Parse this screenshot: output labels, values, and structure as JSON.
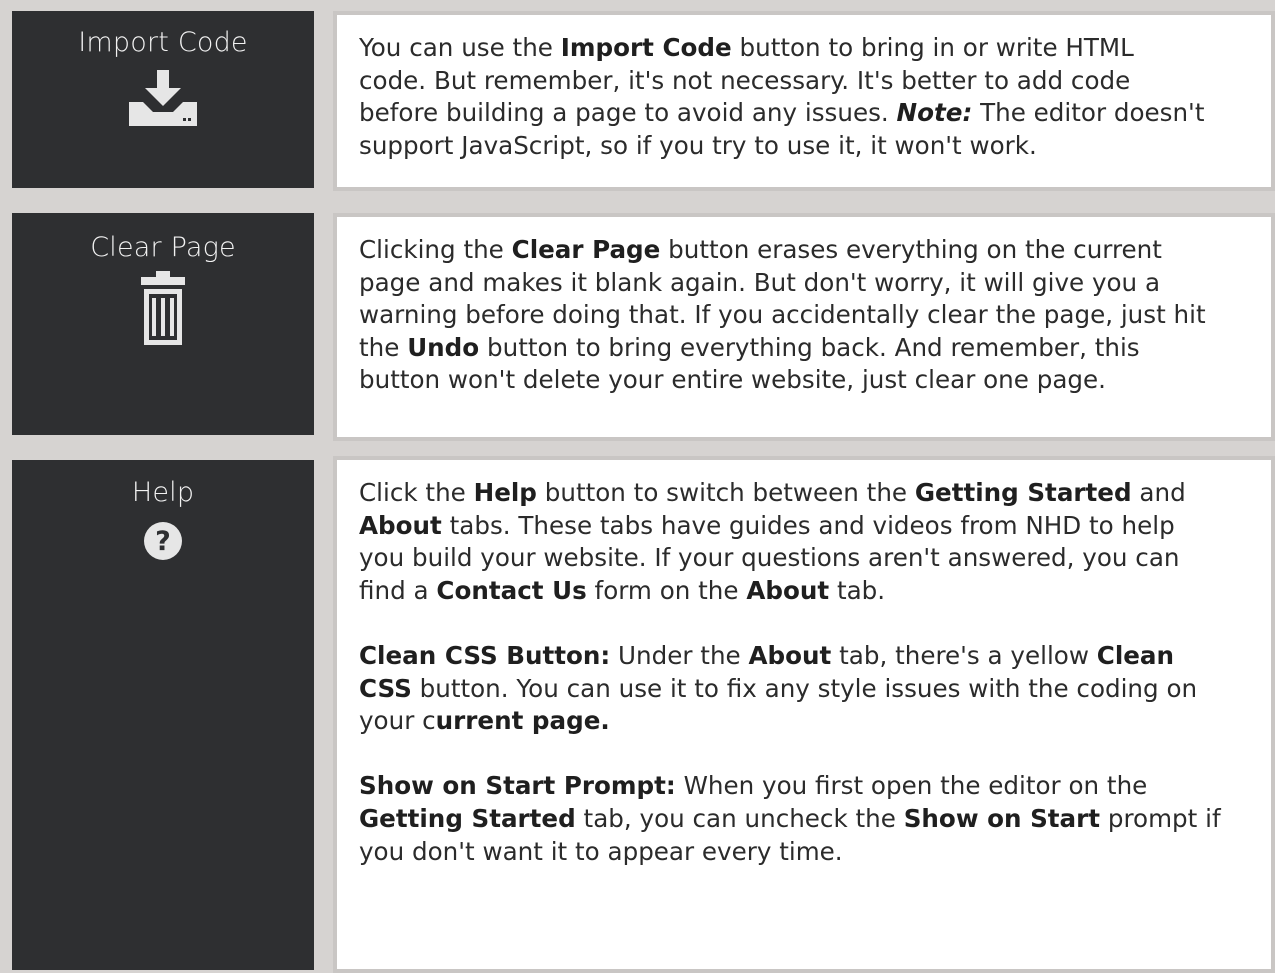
{
  "rows": [
    {
      "button_label": "Import Code",
      "icon": "download-icon",
      "lines": [
        [
          {
            "t": "You can use the "
          },
          {
            "t": "Import Code",
            "b": true
          },
          {
            "t": " button to bring in or write HTML"
          }
        ],
        [
          {
            "t": "code. But remember, it's not necessary. It's better to add code"
          }
        ],
        [
          {
            "t": "before building a page to avoid any issues. "
          },
          {
            "t": "Note:",
            "b": true,
            "i": true
          },
          {
            "t": " The editor doesn't"
          }
        ],
        [
          {
            "t": "support JavaScript, so if you try to use it, it won't work."
          }
        ]
      ]
    },
    {
      "button_label": "Clear Page",
      "icon": "trash-icon",
      "lines": [
        [
          {
            "t": " Clicking the "
          },
          {
            "t": "Clear Page",
            "b": true
          },
          {
            "t": " button erases everything on the current"
          }
        ],
        [
          {
            "t": "page and makes it blank again. But don't worry, it will give you a"
          }
        ],
        [
          {
            "t": "warning before doing that. If you accidentally clear the page, just hit"
          }
        ],
        [
          {
            "t": "the "
          },
          {
            "t": "Undo",
            "b": true
          },
          {
            "t": " button to bring everything back. And remember, this"
          }
        ],
        [
          {
            "t": "button won't delete your entire website, just clear one page."
          }
        ]
      ]
    },
    {
      "button_label": "Help",
      "icon": "help-icon",
      "lines": [
        [
          {
            "t": "Click the "
          },
          {
            "t": "Help",
            "b": true
          },
          {
            "t": " button to switch between the "
          },
          {
            "t": "Getting Started",
            "b": true
          },
          {
            "t": " and"
          }
        ],
        [
          {
            "t": "About",
            "b": true
          },
          {
            "t": " tabs. These tabs have guides and videos from NHD to help"
          }
        ],
        [
          {
            "t": "you build your website. If your questions aren't answered, you can"
          }
        ],
        [
          {
            "t": "find a "
          },
          {
            "t": "Contact Us",
            "b": true
          },
          {
            "t": " form on the "
          },
          {
            "t": "About",
            "b": true
          },
          {
            "t": " tab."
          }
        ],
        [],
        [
          {
            "t": "Clean CSS Button:",
            "b": true
          },
          {
            "t": " Under the "
          },
          {
            "t": "About",
            "b": true
          },
          {
            "t": " tab, there's a yellow "
          },
          {
            "t": "Clean",
            "b": true
          }
        ],
        [
          {
            "t": "CSS",
            "b": true
          },
          {
            "t": " button. You can use it to fix any style issues with the coding on"
          }
        ],
        [
          {
            "t": "your c"
          },
          {
            "t": "urrent page.",
            "b": true
          }
        ],
        [],
        [
          {
            "t": "Show on Start Prompt:",
            "b": true
          },
          {
            "t": " When you first open the editor on the"
          }
        ],
        [
          {
            "t": "Getting Started",
            "b": true
          },
          {
            "t": " tab, you can uncheck the "
          },
          {
            "t": "Show on Start",
            "b": true
          },
          {
            "t": " prompt if"
          }
        ],
        [
          {
            "t": "you don't want it to appear every time."
          }
        ]
      ]
    }
  ],
  "colors": {
    "panel": "#2e2f31",
    "icon": "#e6e6e6",
    "background": "#d6d3d1"
  }
}
